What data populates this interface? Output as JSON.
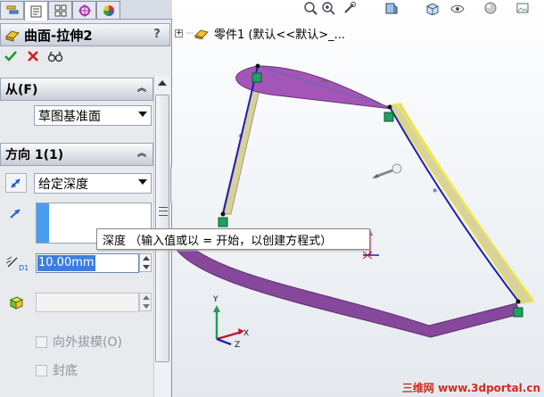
{
  "property_manager": {
    "tabs": [
      "feature-manager",
      "property-manager",
      "configuration-manager",
      "dim-xpert-manager",
      "display-manager"
    ],
    "feature_title": "曲面-拉伸2",
    "help_label": "?",
    "actions": {
      "ok_icon": "check-icon",
      "cancel_icon": "cancel-x-icon",
      "preview_icon": "detailed-preview-icon"
    },
    "from_group": {
      "title": "从(F)",
      "selected": "草图基准面"
    },
    "direction1_group": {
      "title": "方向 1(1)",
      "end_condition": "给定深度",
      "depth_value": "10.00mm",
      "draft_outward_label": "向外拔模(O)",
      "cap_end_label": "封底"
    }
  },
  "graphics": {
    "tree_root_label": "零件1  (默认<<默认>_...",
    "tooltip": "深度 （输入值或以 = 开始，以创建方程式）",
    "hud_icons": [
      "zoom-to-fit-icon",
      "zoom-area-icon",
      "previous-view-icon",
      "section-view-icon",
      "view-orientation-icon",
      "display-style-icon",
      "hide-show-icon",
      "appearance-icon",
      "scene-icon"
    ],
    "colors": {
      "surface_purple": "#a052b6",
      "surface_khaki": "#d8d29a",
      "edge_blue": "#1e1eb4",
      "edge_yellow": "#e8e83c",
      "endpoint_green": "#1fa060"
    }
  },
  "watermark": "三维网 www.3dportal.cn"
}
